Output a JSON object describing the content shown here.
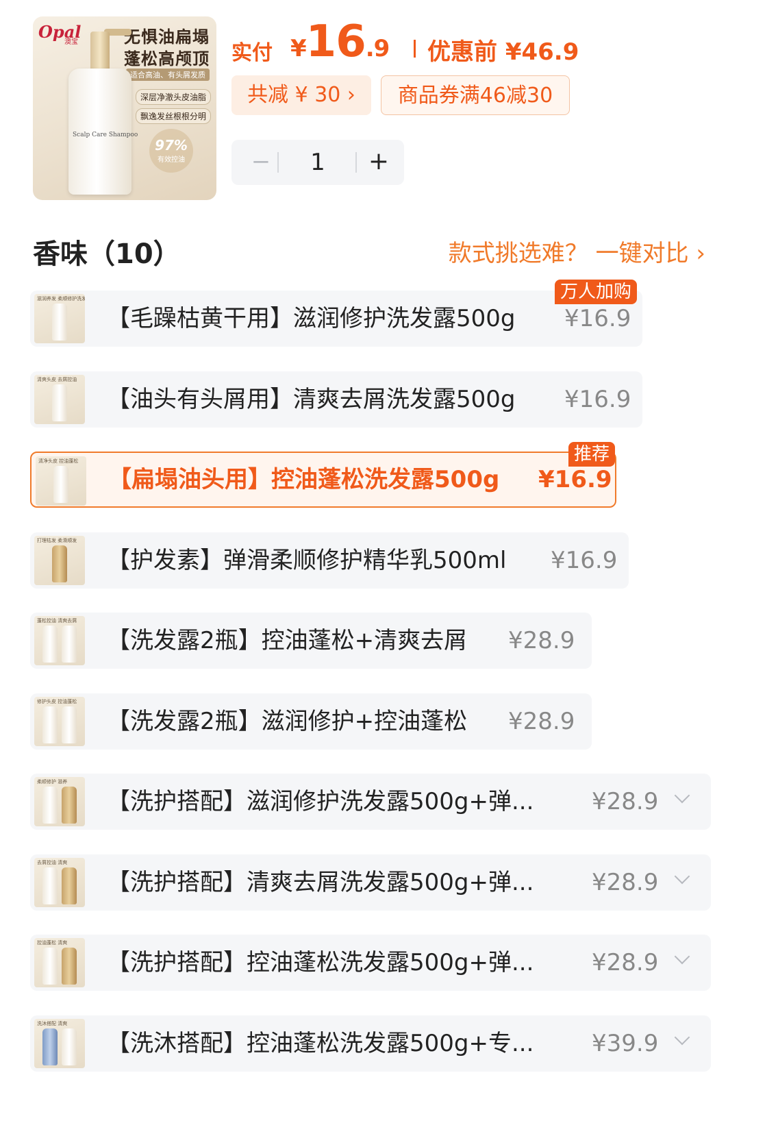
{
  "product_image": {
    "brand": "Opal",
    "brand_cn": "澳宝",
    "slogan_1": "无惧油扁塌",
    "slogan_2": "蓬松高颅顶",
    "tagline": "适合高油、有头屑发质",
    "feature_1": "深层净澈头皮油脂",
    "feature_2": "飘逸发丝根根分明",
    "bottle_text": "Scalp Care Shampoo",
    "badge_percent": "97%",
    "badge_text": "有效控油"
  },
  "price": {
    "pay_label": "实付",
    "currency": "¥",
    "pay_int": "16",
    "pay_dec": ".9",
    "before_label": "优惠前 ¥46.9"
  },
  "discount_chip": "共减 ¥ 30 ›",
  "coupon_chip": "商品券满46减30",
  "quantity": {
    "minus": "−",
    "value": "1",
    "plus": "+"
  },
  "section": {
    "title": "香味（10）",
    "compare_link": "款式挑选难？ 一键对比 ›"
  },
  "options": [
    {
      "label": "【毛躁枯黄干用】滋润修护洗发露500g",
      "price": "¥16.9",
      "badge": "万人加购",
      "thumb_caption": "滋润养发 柔顺修护洗发"
    },
    {
      "label": "【油头有头屑用】清爽去屑洗发露500g",
      "price": "¥16.9",
      "thumb_caption": "清爽头皮 去屑控油"
    },
    {
      "label": "【扁塌油头用】控油蓬松洗发露500g",
      "price": "¥16.9",
      "badge": "推荐",
      "thumb_caption": "清净头皮 控油蓬松"
    },
    {
      "label": "【护发素】弹滑柔顺修护精华乳500ml",
      "price": "¥16.9",
      "thumb_caption": "打理枯发 柔滑顺发"
    },
    {
      "label": "【洗发露2瓶】控油蓬松+清爽去屑",
      "price": "¥28.9",
      "thumb_caption": "蓬松控油 清爽去屑"
    },
    {
      "label": "【洗发露2瓶】滋润修护+控油蓬松",
      "price": "¥28.9",
      "thumb_caption": "修护头皮 控油蓬松"
    },
    {
      "label": "【洗护搭配】滋润修护洗发露500g+弹...",
      "price": "¥28.9",
      "thumb_caption": "柔顺修护 滋养"
    },
    {
      "label": "【洗护搭配】清爽去屑洗发露500g+弹...",
      "price": "¥28.9",
      "thumb_caption": "去屑控油 清爽"
    },
    {
      "label": "【洗护搭配】控油蓬松洗发露500g+弹...",
      "price": "¥28.9",
      "thumb_caption": "控油蓬松 清爽"
    },
    {
      "label": "【洗沐搭配】控油蓬松洗发露500g+专...",
      "price": "¥39.9",
      "thumb_caption": "洗沐搭配 清爽"
    }
  ],
  "colors": {
    "accent": "#f05a1a",
    "link": "#f07a2a",
    "row_bg": "#f5f6f8"
  }
}
